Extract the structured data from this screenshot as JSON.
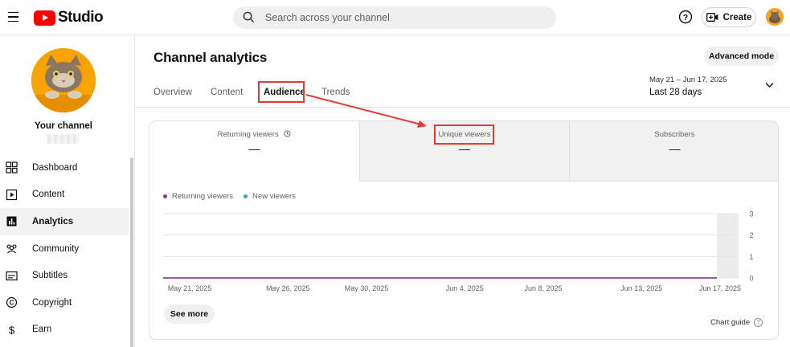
{
  "header": {
    "logo_text": "Studio",
    "search_placeholder": "Search across your channel",
    "create_label": "Create"
  },
  "sidebar": {
    "channel_label": "Your channel",
    "items": [
      {
        "label": "Dashboard",
        "icon": "dashboard-icon"
      },
      {
        "label": "Content",
        "icon": "content-icon"
      },
      {
        "label": "Analytics",
        "icon": "analytics-icon",
        "active": true
      },
      {
        "label": "Community",
        "icon": "community-icon"
      },
      {
        "label": "Subtitles",
        "icon": "subtitles-icon"
      },
      {
        "label": "Copyright",
        "icon": "copyright-icon"
      },
      {
        "label": "Earn",
        "icon": "earn-icon"
      }
    ]
  },
  "main": {
    "title": "Channel analytics",
    "advanced_mode_label": "Advanced mode",
    "tabs": [
      {
        "label": "Overview"
      },
      {
        "label": "Content"
      },
      {
        "label": "Audience",
        "active": true
      },
      {
        "label": "Trends"
      }
    ],
    "date_range": {
      "range": "May 21 – Jun 17, 2025",
      "label": "Last 28 days"
    }
  },
  "metrics": [
    {
      "label": "Returning viewers",
      "value": "—",
      "has_info_icon": true
    },
    {
      "label": "Unique viewers",
      "value": "—"
    },
    {
      "label": "Subscribers",
      "value": "—"
    }
  ],
  "chart_data": {
    "type": "line",
    "x": [
      "May 21, 2025",
      "May 26, 2025",
      "May 30, 2025",
      "Jun 4, 2025",
      "Jun 8, 2025",
      "Jun 13, 2025",
      "Jun 17, 2025"
    ],
    "series": [
      {
        "name": "Returning viewers",
        "color": "#9c27b0",
        "values": [
          0,
          0,
          0,
          0,
          0,
          0,
          0
        ]
      },
      {
        "name": "New viewers",
        "color": "#2ea2c4",
        "values": [
          0,
          0,
          0,
          0,
          0,
          0,
          0
        ]
      }
    ],
    "y_ticks": [
      "0",
      "1",
      "2",
      "3"
    ],
    "ylim": [
      0,
      3
    ],
    "grid": true,
    "legend": "top-left"
  },
  "footer": {
    "see_more_label": "See more",
    "chart_guide_label": "Chart guide"
  },
  "colors": {
    "accent_red": "#ff0000",
    "highlight_red": "#e53935",
    "series_purple": "#9c27b0",
    "series_teal": "#2ea2c4"
  }
}
